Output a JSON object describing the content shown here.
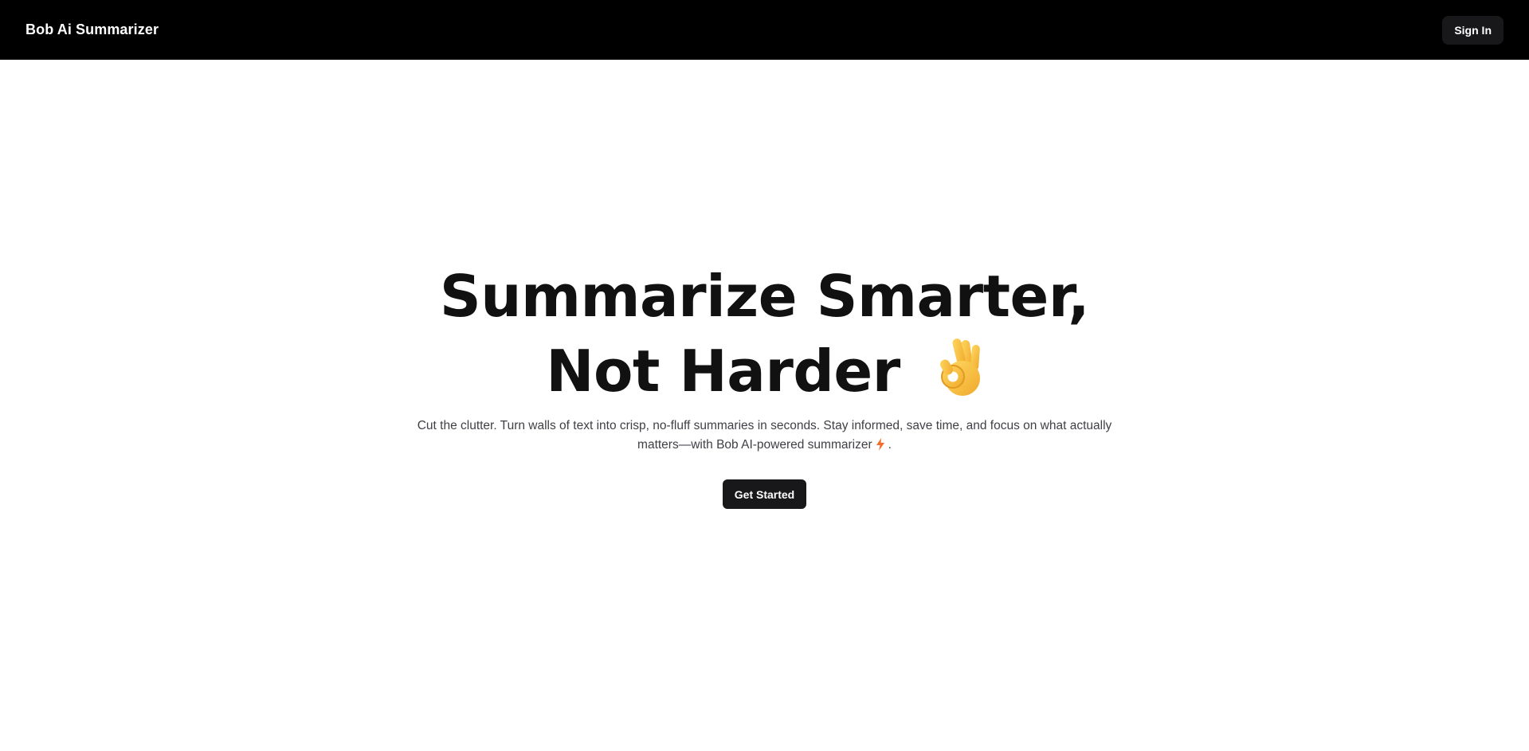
{
  "header": {
    "brand": "Bob Ai Summarizer",
    "signin_label": "Sign In"
  },
  "hero": {
    "headline_line1": "Summarize Smarter,",
    "headline_line2": "Not Harder",
    "headline_emoji_icon": "ok-hand-icon",
    "subtitle_part1": "Cut the clutter. Turn walls of text into crisp, no-fluff summaries in seconds. Stay informed, save time, and focus on what actually matters—with Bob AI-powered summarizer",
    "subtitle_icon": "lightning-bolt-icon",
    "subtitle_part2": ".",
    "cta_label": "Get Started"
  },
  "colors": {
    "navbar_bg": "#000000",
    "button_bg": "#18181b",
    "headline_text": "#111111",
    "subtitle_text": "#3f3f46",
    "bolt_color": "#f26b2a",
    "emoji_yellow": "#f8c13a"
  }
}
